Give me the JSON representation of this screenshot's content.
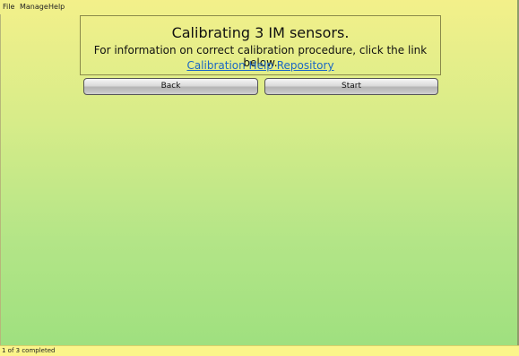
{
  "menu": {
    "file": "File",
    "manage": "Manage",
    "help": "Help"
  },
  "panel": {
    "title": "Calibrating 3 IM sensors.",
    "info": "For information on correct calibration procedure, click the link below.",
    "link": "Calibration Help Repository"
  },
  "buttons": {
    "back": "Back",
    "start": "Start"
  },
  "status": {
    "text": "1 of 3 completed"
  },
  "colors": {
    "background_top": "#f3f08a",
    "background_bottom": "#9fe07f",
    "link": "#1a66c4",
    "statusbar": "#fbf58a"
  }
}
